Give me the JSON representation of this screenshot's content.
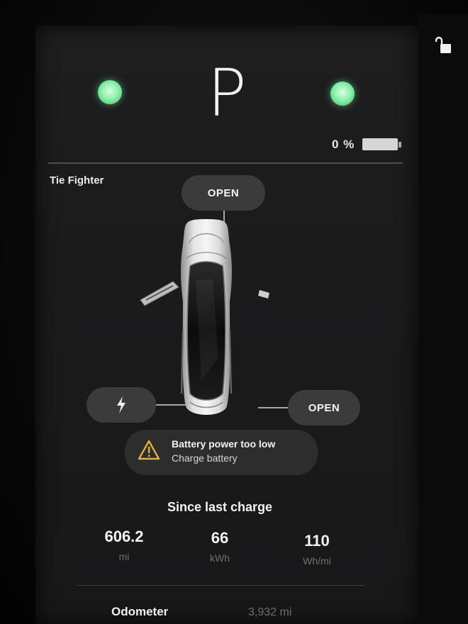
{
  "status": {
    "gear": "P",
    "battery_percent": "0 %",
    "indicator_color": "#8ff0ad"
  },
  "vehicle": {
    "name": "Tie Fighter"
  },
  "controls": {
    "frunk_label": "OPEN",
    "trunk_label": "OPEN",
    "charge_port_icon": "lightning-bolt-icon"
  },
  "alert": {
    "icon": "warning-triangle-icon",
    "title": "Battery power too low",
    "subtitle": "Charge battery"
  },
  "trip": {
    "title": "Since last charge",
    "stats": [
      {
        "value": "606.2",
        "unit": "mi"
      },
      {
        "value": "66",
        "unit": "kWh"
      },
      {
        "value": "110",
        "unit": "Wh/mi"
      }
    ]
  },
  "odometer": {
    "label": "Odometer",
    "value": "3,932 mi"
  },
  "colors": {
    "warning": "#e2b33a",
    "pill_bg": "#3b3b3c",
    "screen_bg": "#1c1c1d"
  }
}
